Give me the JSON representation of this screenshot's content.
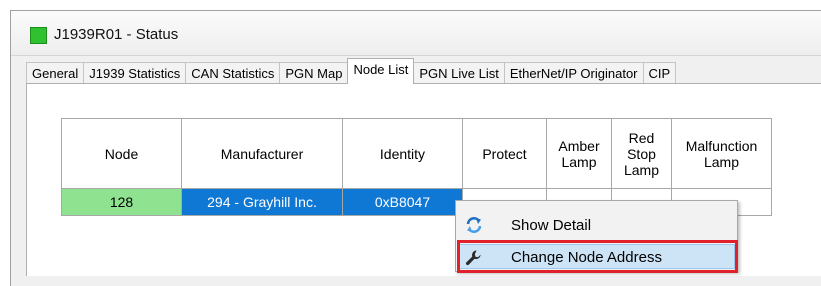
{
  "window": {
    "title": "J1939R01 - Status",
    "status_color": "#2fc12f"
  },
  "tabs": [
    {
      "label": "General"
    },
    {
      "label": "J1939 Statistics"
    },
    {
      "label": "CAN Statistics"
    },
    {
      "label": "PGN Map"
    },
    {
      "label": "Node List",
      "active": true
    },
    {
      "label": "PGN Live List"
    },
    {
      "label": "EtherNet/IP Originator"
    },
    {
      "label": "CIP"
    }
  ],
  "table": {
    "headers": [
      "Node",
      "Manufacturer",
      "Identity",
      "Protect",
      "Amber Lamp",
      "Red Stop Lamp",
      "Malfunction Lamp"
    ],
    "rows": [
      {
        "node": "128",
        "manufacturer": "294 - Grayhill Inc.",
        "identity": "0xB8047",
        "protect": "",
        "amber": "",
        "red": "",
        "malfunction": "-"
      }
    ]
  },
  "context_menu": {
    "items": [
      {
        "label": "Show Detail",
        "icon": "refresh-icon"
      },
      {
        "label": "Change Node Address",
        "icon": "wrench-icon",
        "highlighted": true
      }
    ],
    "highlight_outline_color": "#e0202a"
  }
}
